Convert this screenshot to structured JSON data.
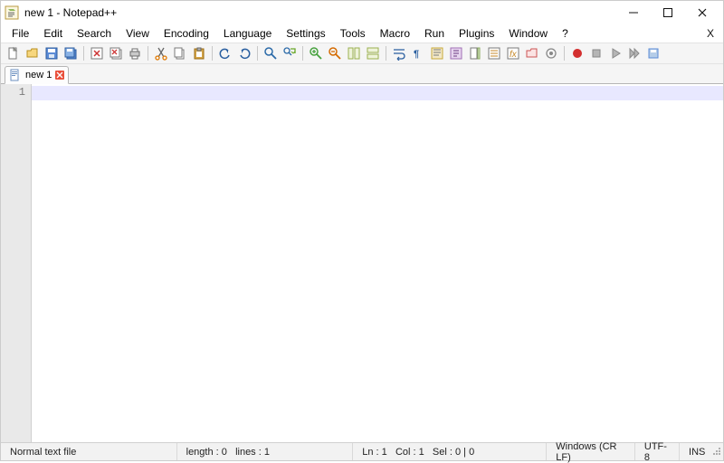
{
  "window": {
    "title": "new 1 - Notepad++"
  },
  "menu": {
    "file": "File",
    "edit": "Edit",
    "search": "Search",
    "view": "View",
    "encoding": "Encoding",
    "language": "Language",
    "settings": "Settings",
    "tools": "Tools",
    "macro": "Macro",
    "run": "Run",
    "plugins": "Plugins",
    "window": "Window",
    "help": "?",
    "close_doc": "X"
  },
  "tab": {
    "label": "new 1"
  },
  "editor": {
    "line1": "1"
  },
  "status": {
    "filetype": "Normal text file",
    "length": "length : 0",
    "lines": "lines : 1",
    "ln": "Ln : 1",
    "col": "Col : 1",
    "sel": "Sel : 0 | 0",
    "eol": "Windows (CR LF)",
    "encoding": "UTF-8",
    "mode": "INS"
  }
}
